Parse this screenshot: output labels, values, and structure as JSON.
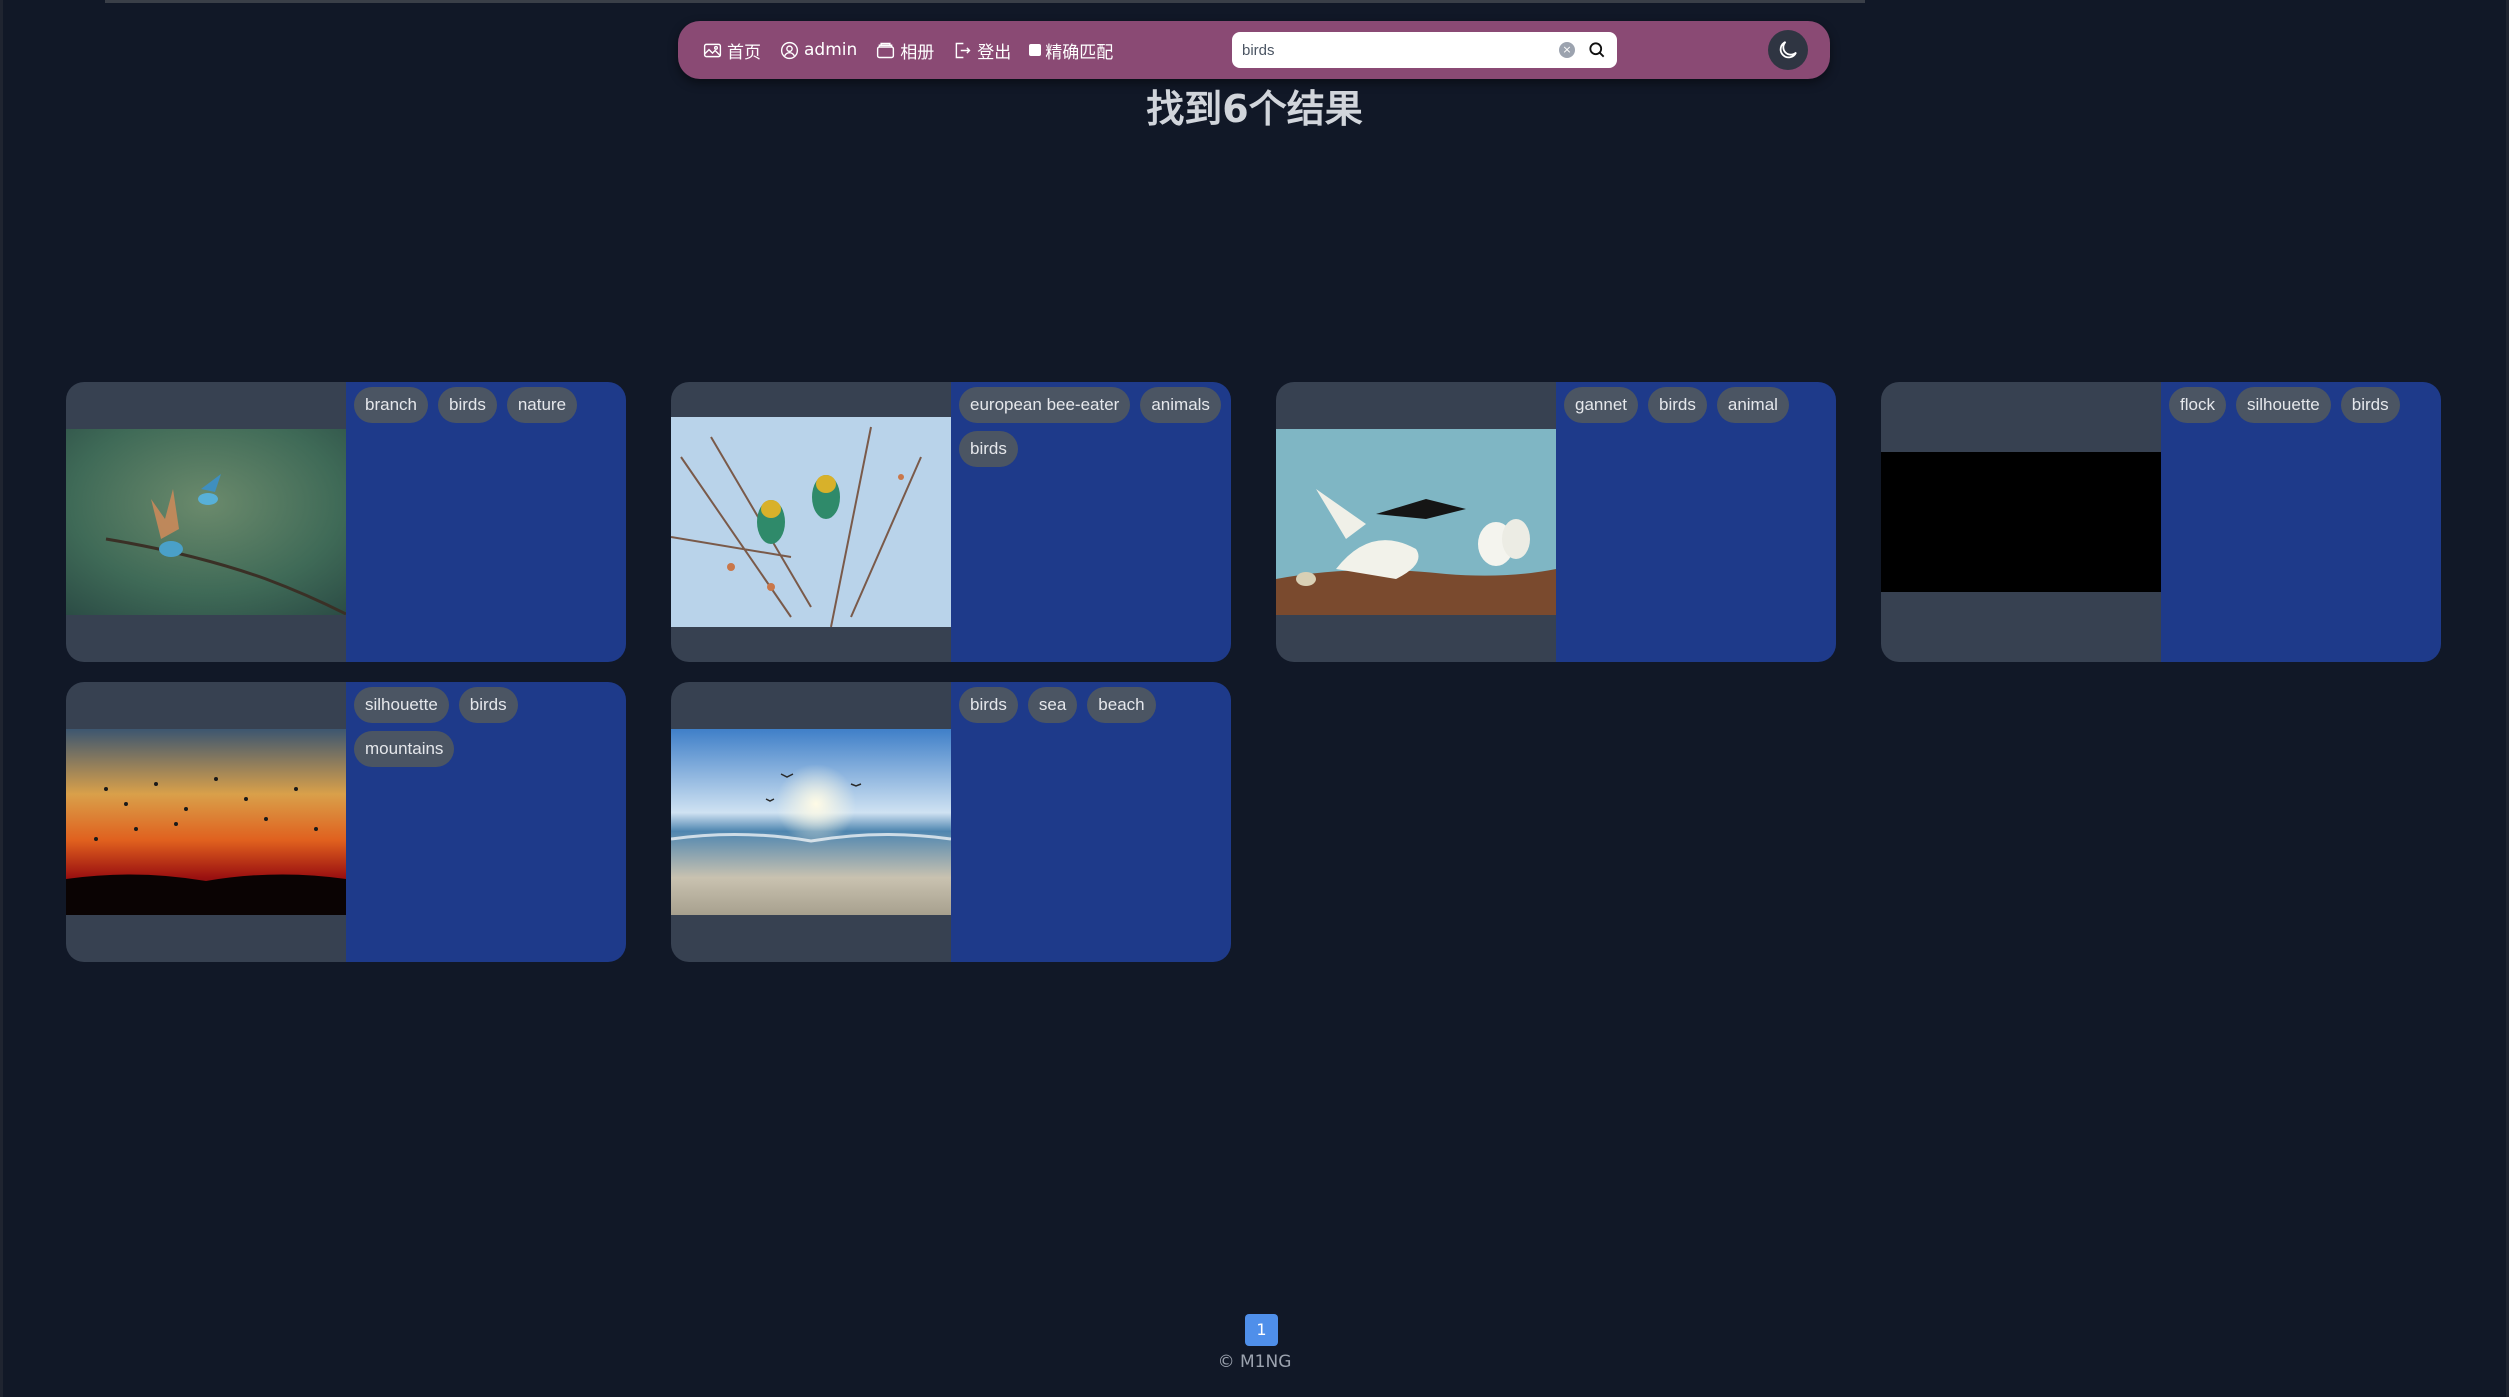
{
  "nav": {
    "home_label": "首页",
    "user_label": "admin",
    "album_label": "相册",
    "logout_label": "登出",
    "exact_match_label": "精确匹配"
  },
  "search": {
    "value": "birds",
    "clear_symbol": "×"
  },
  "results": {
    "title": "找到6个结果"
  },
  "cards": [
    {
      "tags": [
        "branch",
        "birds",
        "nature"
      ],
      "image": "bee-eater-flying-branch"
    },
    {
      "tags": [
        "european bee-eater",
        "animals",
        "birds"
      ],
      "image": "bee-eaters-on-branch"
    },
    {
      "tags": [
        "gannet",
        "birds",
        "animal"
      ],
      "image": "gannets-on-cliff"
    },
    {
      "tags": [
        "flock",
        "silhouette",
        "birds"
      ],
      "image": "black-placeholder"
    },
    {
      "tags": [
        "silhouette",
        "birds",
        "mountains"
      ],
      "image": "sunset-flock"
    },
    {
      "tags": [
        "birds",
        "sea",
        "beach"
      ],
      "image": "beach-birds"
    }
  ],
  "pagination": {
    "current": "1"
  },
  "footer": {
    "text": "© M1NG"
  },
  "colors": {
    "background": "#111827",
    "navbar": "#8a4a74",
    "tag_panel": "#1e3a8a",
    "image_panel": "#374151",
    "tag": "#4b5563",
    "page_active": "#4f8fea"
  },
  "icons": [
    "image-icon",
    "user-circle-icon",
    "album-icon",
    "logout-icon",
    "search-icon",
    "moon-icon",
    "clear-icon"
  ]
}
